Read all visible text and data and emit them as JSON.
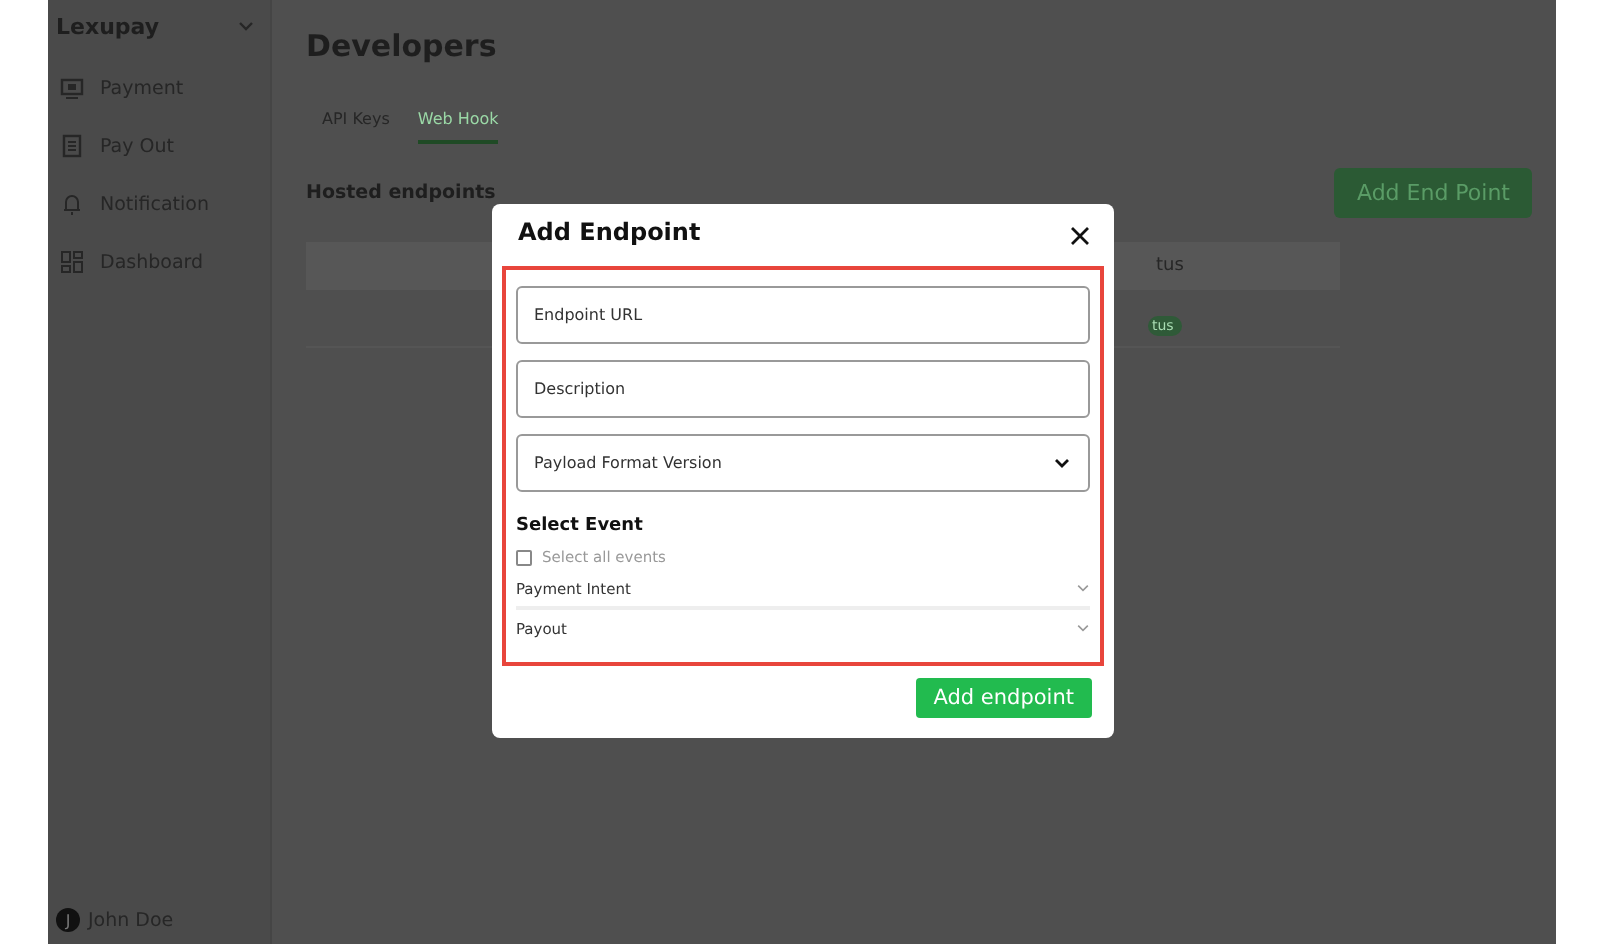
{
  "sidebar": {
    "brand": "Lexupay",
    "items": [
      {
        "label": "Payment",
        "kind": "payment"
      },
      {
        "label": "Pay Out",
        "kind": "payout"
      },
      {
        "label": "Notification",
        "kind": "bell"
      },
      {
        "label": "Dashboard",
        "kind": "grid"
      }
    ],
    "user": {
      "initial": "J",
      "name": "John Doe"
    }
  },
  "page": {
    "title": "Developers",
    "tabs": [
      {
        "label": "API Keys",
        "selected": false
      },
      {
        "label": "Web Hook",
        "selected": true
      }
    ],
    "section_title": "Hosted endpoints",
    "add_button": "Add End Point",
    "table": {
      "column_header": "tus",
      "badge": "tus"
    }
  },
  "modal": {
    "title": "Add Endpoint",
    "fields": [
      {
        "kind": "input",
        "placeholder": "Endpoint URL"
      },
      {
        "kind": "input",
        "placeholder": "Description"
      },
      {
        "kind": "select",
        "placeholder": "Payload Format Version"
      }
    ],
    "event_heading": "Select Event",
    "select_all": {
      "label": "Select all events",
      "checked": false
    },
    "events": [
      {
        "label": "Payment Intent",
        "expanded": false
      },
      {
        "label": "Payout",
        "expanded": false
      }
    ],
    "submit": "Add endpoint"
  }
}
